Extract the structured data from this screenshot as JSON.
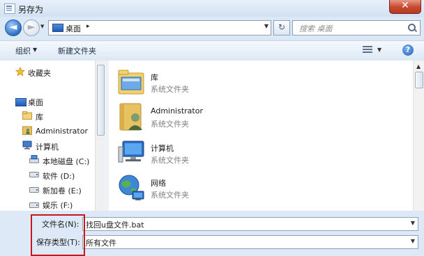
{
  "window": {
    "title": "另存为",
    "close_glyph": "✕"
  },
  "navbar": {
    "back_glyph": "◄",
    "forward_glyph": "►",
    "address": {
      "location": "桌面",
      "separator": "▸"
    },
    "refresh_glyph": "↻",
    "search_placeholder": "搜索 桌面"
  },
  "toolbar": {
    "organize_label": "组织",
    "new_folder_label": "新建文件夹",
    "help_glyph": "?"
  },
  "navpane": {
    "favorites": "收藏夹",
    "desktop": "桌面",
    "libraries": "库",
    "user": "Administrator",
    "computer": "计算机",
    "drives": [
      "本地磁盘 (C:)",
      "软件 (D:)",
      "新加卷 (E:)",
      "娱乐 (F:)"
    ]
  },
  "files": [
    {
      "name": "库",
      "type": "系统文件夹",
      "icon": "library-icon"
    },
    {
      "name": "Administrator",
      "type": "系统文件夹",
      "icon": "user-folder-icon"
    },
    {
      "name": "计算机",
      "type": "系统文件夹",
      "icon": "computer-icon"
    },
    {
      "name": "网络",
      "type": "系统文件夹",
      "icon": "network-icon"
    }
  ],
  "form": {
    "filename_label": "文件名(N):",
    "filename_value": "找回u盘文件.bat",
    "filetype_label": "保存类型(T):",
    "filetype_value": "所有文件"
  },
  "colors": {
    "highlight": "#c8161d",
    "window_bg": "#dbe8f6"
  }
}
